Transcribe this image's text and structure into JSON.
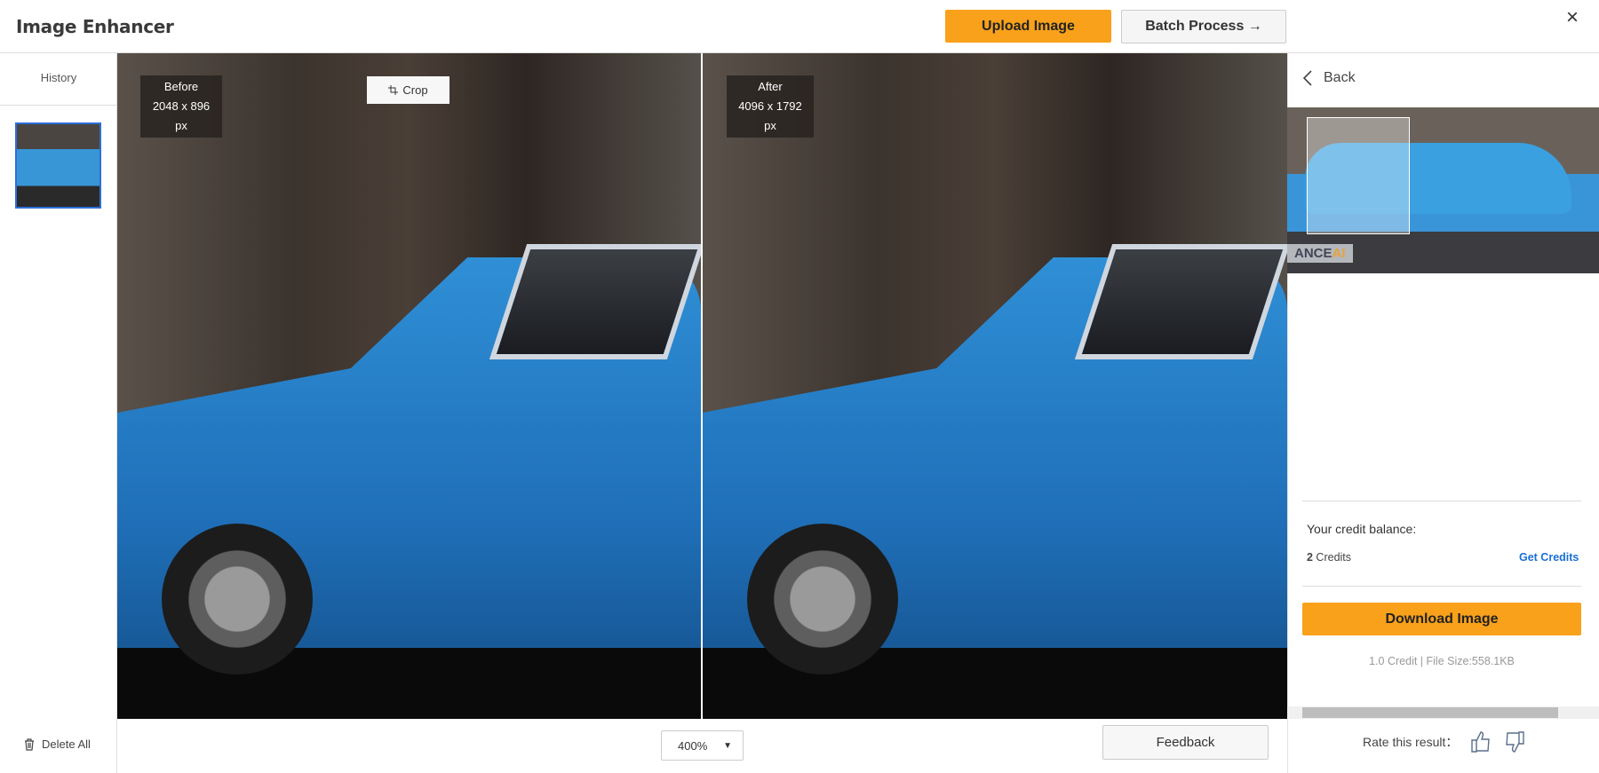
{
  "header": {
    "title": "Image Enhancer",
    "upload_label": "Upload Image",
    "batch_label": "Batch Process →",
    "close_icon": "×"
  },
  "sidebar": {
    "history_label": "History",
    "delete_all_label": "Delete All"
  },
  "viewer": {
    "before": {
      "label": "Before",
      "size": "2048 x 896 px"
    },
    "after": {
      "label": "After",
      "size": "4096 x 1792 px"
    },
    "crop_label": "Crop",
    "zoom_value": "400%",
    "feedback_label": "Feedback"
  },
  "panel": {
    "back_label": "Back",
    "logo_text": "ANCE",
    "logo_accent": "AI",
    "credit_balance_label": "Your credit balance:",
    "credits_count": "2",
    "credits_unit": " Credits",
    "get_credits_label": "Get Credits",
    "download_label": "Download Image",
    "file_info": "1.0 Credit | File Size:558.1KB",
    "rate_label": "Rate this result："
  },
  "colors": {
    "accent": "#f9a11b",
    "link": "#1a6fd6",
    "selected_border": "#2d6fd8"
  }
}
